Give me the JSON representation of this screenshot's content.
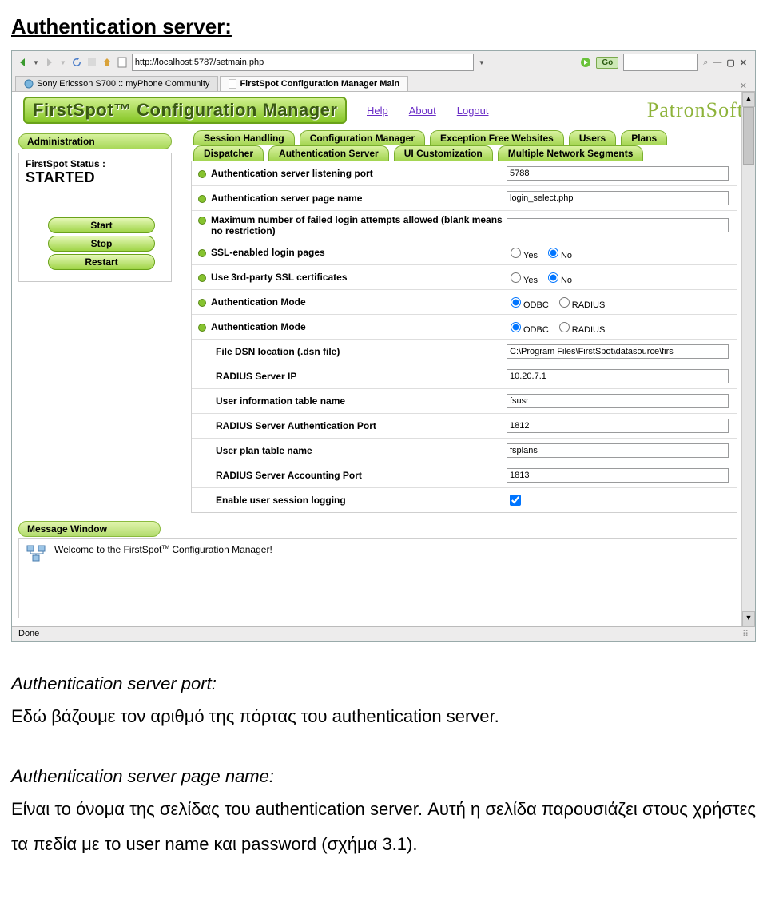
{
  "doc": {
    "title": "Authentication server:",
    "sections": [
      {
        "heading": "Authentication server port:",
        "body": "Εδώ βάζουμε τον αριθμό της πόρτας του authentication server."
      },
      {
        "heading": "Authentication server page name:",
        "body": "Είναι το όνομα της σελίδας του authentication server. Αυτή η σελίδα παρουσιάζει στους χρήστες τα πεδία με το user name και password (σχήμα 3.1)."
      }
    ]
  },
  "browser": {
    "url": "http://localhost:5787/setmain.php",
    "go": "Go",
    "win": {
      "min": "—",
      "max": "▢",
      "close": "✕"
    },
    "tabs": [
      "Sony Ericsson S700 :: myPhone Community",
      "FirstSpot Configuration Manager Main"
    ],
    "active_tab": 1,
    "statusbar": "Done"
  },
  "page": {
    "logo": "FirstSpot™ Configuration Manager",
    "links": [
      "Help",
      "About",
      "Logout"
    ],
    "brand": "PatronSoft",
    "left": {
      "header": "Administration",
      "status_label": "FirstSpot Status :",
      "status_value": "STARTED",
      "buttons": [
        "Start",
        "Stop",
        "Restart"
      ]
    },
    "navtabs_row1": [
      "Session Handling",
      "Configuration Manager",
      "Exception Free Websites",
      "Users",
      "Plans"
    ],
    "navtabs_row2": [
      "Dispatcher",
      "Authentication Server",
      "UI Customization",
      "Multiple Network Segments"
    ],
    "settings": [
      {
        "bullet": true,
        "label": "Authentication server listening port",
        "type": "text",
        "value": "5788"
      },
      {
        "bullet": true,
        "label": "Authentication server page name",
        "type": "text",
        "value": "login_select.php"
      },
      {
        "bullet": true,
        "label": "Maximum number of failed login attempts allowed (blank means no restriction)",
        "type": "text",
        "value": ""
      },
      {
        "bullet": true,
        "label": "SSL-enabled login pages",
        "type": "yesno",
        "value": "No"
      },
      {
        "bullet": true,
        "label": "Use 3rd-party SSL certificates",
        "type": "yesno",
        "value": "No"
      },
      {
        "bullet": true,
        "label": "Authentication Mode",
        "type": "mode",
        "value": "ODBC"
      },
      {
        "bullet": true,
        "label": "Authentication Mode",
        "type": "mode",
        "value": "ODBC"
      },
      {
        "bullet": false,
        "indent": true,
        "label": "File DSN location (.dsn file)",
        "type": "text",
        "value": "C:\\Program Files\\FirstSpot\\datasource\\firs"
      },
      {
        "bullet": false,
        "indent": true,
        "label": "RADIUS Server IP",
        "type": "text",
        "value": "10.20.7.1"
      },
      {
        "bullet": false,
        "indent": true,
        "label": "User information table name",
        "type": "text",
        "value": "fsusr"
      },
      {
        "bullet": false,
        "indent": true,
        "label": "RADIUS Server Authentication Port",
        "type": "text",
        "value": "1812"
      },
      {
        "bullet": false,
        "indent": true,
        "label": "User plan table name",
        "type": "text",
        "value": "fsplans"
      },
      {
        "bullet": false,
        "indent": true,
        "label": "RADIUS Server Accounting Port",
        "type": "text",
        "value": "1813"
      },
      {
        "bullet": false,
        "indent": true,
        "label": "Enable user session logging",
        "type": "check",
        "value": true
      }
    ],
    "yesno": {
      "yes": "Yes",
      "no": "No"
    },
    "mode": {
      "odbc": "ODBC",
      "radius": "RADIUS"
    },
    "msg": {
      "header": "Message Window",
      "text_a": "Welcome to the FirstSpot",
      "text_b": " Configuration Manager!",
      "tm": "TM"
    }
  }
}
